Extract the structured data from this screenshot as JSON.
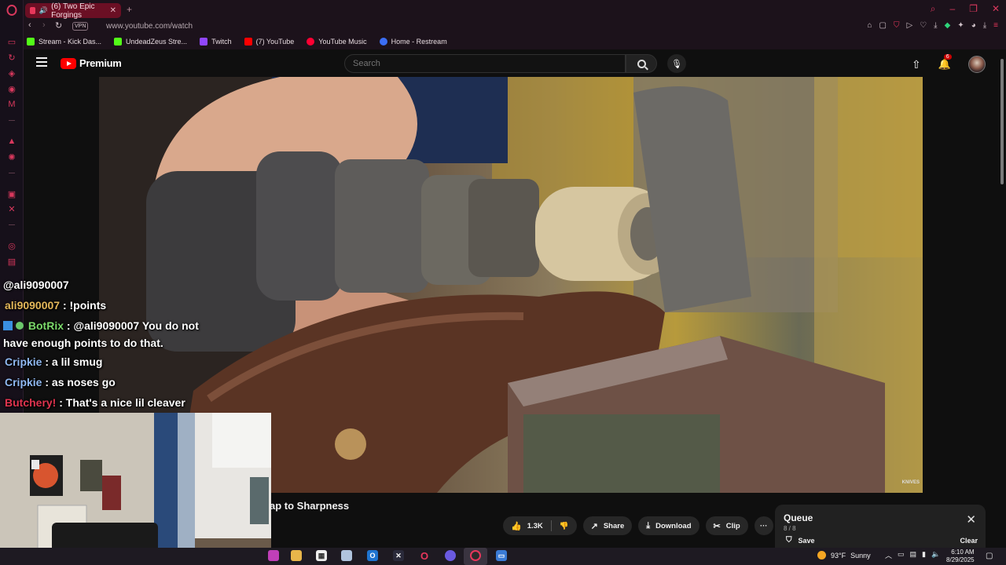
{
  "browser": {
    "tab_title": "(6) Two Epic Forgings",
    "url": "www.youtube.com/watch",
    "vpn_label": "VPN",
    "accent": "#d8385d"
  },
  "bookmarks": [
    {
      "label": "Stream - Kick Das...",
      "color": "#53fc18"
    },
    {
      "label": "UndeadZeus Stre...",
      "color": "#53fc18"
    },
    {
      "label": "Twitch",
      "color": "#9146ff"
    },
    {
      "label": "(7) YouTube",
      "color": "#ff0000"
    },
    {
      "label": "YouTube Music",
      "color": "#ff0033"
    },
    {
      "label": "Home - Restream",
      "color": "#3b6ef5"
    }
  ],
  "youtube": {
    "logo_text": "Premium",
    "search_placeholder": "Search",
    "notification_count": "6"
  },
  "chat": {
    "mention": "@ali9090007",
    "messages": [
      {
        "user": "ali9090007",
        "user_color": "#e3b75a",
        "text": ": !points"
      },
      {
        "user": "BotRix",
        "user_color": "#7bd96a",
        "text": ": @ali9090007 You do not have enough points to do that."
      },
      {
        "user": "Cripkie",
        "user_color": "#8fb8f0",
        "text": ": a lil smug"
      },
      {
        "user": "Cripkie",
        "user_color": "#8fb8f0",
        "text": ": as noses go"
      },
      {
        "user": "Butchery!",
        "user_color": "#e0344f",
        "text": ": That's a nice lil cleaver"
      }
    ]
  },
  "video": {
    "title_fragment": "ap to Sharpness",
    "watermark": "KNIVES"
  },
  "actions": {
    "like_count": "1.3K",
    "share": "Share",
    "download": "Download",
    "clip": "Clip",
    "more": "···"
  },
  "queue": {
    "title": "Queue",
    "count": "8 / 8",
    "save": "Save",
    "clear": "Clear"
  },
  "taskbar": {
    "weather_temp": "93°F",
    "weather_desc": "Sunny",
    "time": "6:10 AM",
    "date": "8/29/2025"
  }
}
